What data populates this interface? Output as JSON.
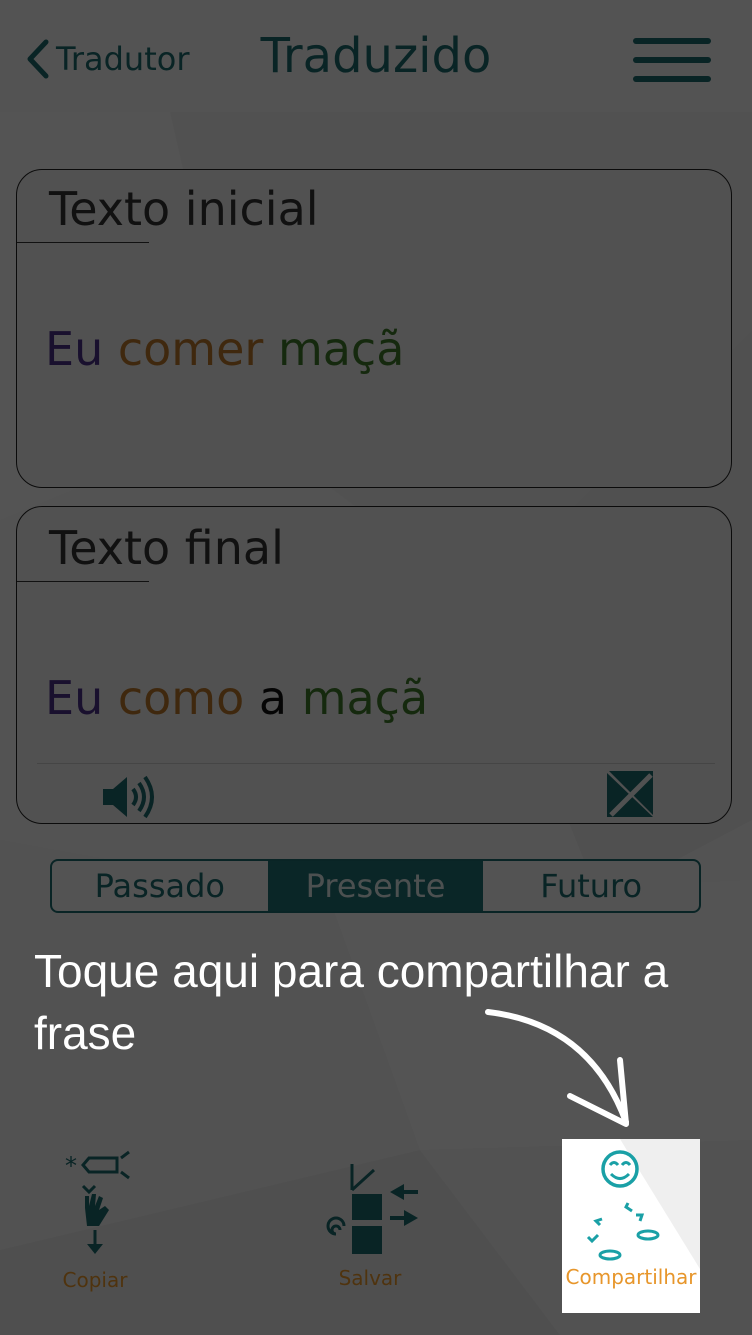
{
  "header": {
    "back_label": "Tradutor",
    "title": "Traduzido"
  },
  "input_card": {
    "title": "Texto inicial",
    "words": [
      "Eu",
      "comer",
      "maçã"
    ]
  },
  "output_card": {
    "title": "Texto final",
    "words": [
      "Eu",
      "como",
      "a",
      "maçã"
    ]
  },
  "tenses": {
    "options": [
      "Passado",
      "Presente",
      "Futuro"
    ],
    "selected": "Presente"
  },
  "hint": {
    "text": "Toque aqui para compartilhar a frase"
  },
  "toolbar": {
    "copy_label": "Copiar",
    "save_label": "Salvar",
    "share_label": "Compartilhar"
  },
  "colors": {
    "accent": "#1d6a6e",
    "subject": "#4b2f86",
    "verb": "#b9772a",
    "object": "#3f7a2b",
    "toolbar_label": "#e7962b"
  }
}
